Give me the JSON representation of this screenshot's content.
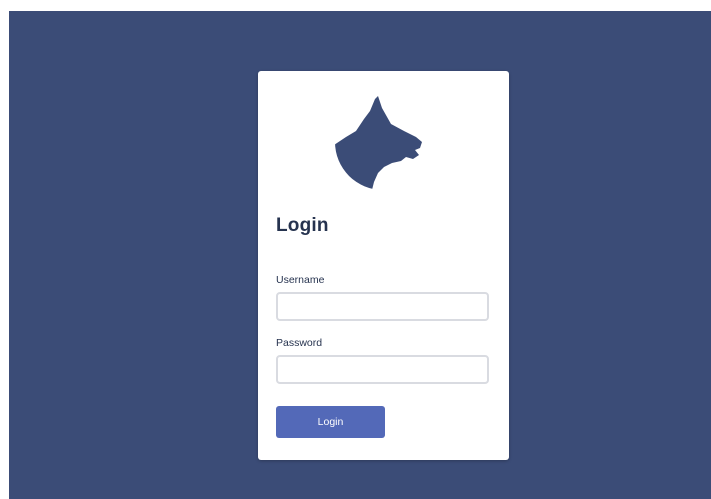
{
  "colors": {
    "background": "#3b4c77",
    "card": "#ffffff",
    "primary_button": "#5369b8",
    "text_dark": "#26334f",
    "input_border": "#d9dbe1"
  },
  "logo": {
    "icon": "dog-head-logo-icon"
  },
  "login_form": {
    "title": "Login",
    "username_label": "Username",
    "username_value": "",
    "username_placeholder": "",
    "password_label": "Password",
    "password_value": "",
    "password_placeholder": "",
    "submit_label": "Login"
  }
}
